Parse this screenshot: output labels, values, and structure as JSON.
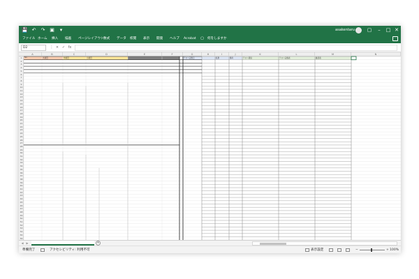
{
  "titlebar": {
    "user": "asakentaru",
    "quick_access": [
      "save-icon",
      "undo-icon",
      "redo-icon",
      "camera-icon",
      "dropdown-icon"
    ],
    "window_controls": [
      "ribbon-display-icon",
      "minimize-icon",
      "maximize-icon",
      "close-icon"
    ]
  },
  "ribbon": {
    "tabs": [
      "ファイル",
      "ホーム",
      "挿入",
      "描画",
      "ページレイアウト",
      "数式",
      "データ",
      "校閲",
      "表示",
      "開発",
      "ヘルプ",
      "Acrobat"
    ],
    "tell_me": "何をしますか"
  },
  "formula_bar": {
    "name_box": "D2",
    "cancel": "×",
    "enter": "✓",
    "function": "fx",
    "value": ""
  },
  "grid": {
    "col_headers": [
      "A",
      "B",
      "C",
      "D",
      "E",
      "F",
      "G",
      "H",
      "I",
      "J",
      "K",
      "L",
      "M",
      "N"
    ],
    "row_headers": [
      "1",
      "2",
      "3",
      "4",
      "5",
      "6",
      "7",
      "8",
      "9",
      "10",
      "11",
      "12",
      "13",
      "14",
      "15",
      "16",
      "17",
      "18",
      "19",
      "20",
      "21",
      "22",
      "23",
      "24",
      "25",
      "26",
      "27",
      "28",
      "29",
      "30",
      "31",
      "32",
      "33",
      "34",
      "35",
      "36",
      "37",
      "38",
      "39",
      "40",
      "41",
      "42",
      "43",
      "44",
      "45",
      "46",
      "47",
      "48",
      "49",
      "50",
      "51",
      "52",
      "53",
      "54",
      "55",
      "56"
    ],
    "left_headers": [
      "No.",
      "大項目",
      "中項目",
      "小項目"
    ],
    "right_headers": [
      "テスト実施日",
      "結果",
      "備考",
      "テスト環境",
      "テスト実施者",
      "確認者"
    ]
  },
  "sheet_bar": {
    "prev": "◀",
    "next": "▶",
    "add": "+"
  },
  "status": {
    "ready": "準備完了",
    "accessibility": "アクセシビリティ: 利用不可",
    "display_settings": "表示設定",
    "zoom_minus": "−",
    "zoom_plus": "+",
    "zoom": "100%"
  },
  "colors": {
    "excel_green": "#217346",
    "header_orange": "#f8cbad",
    "header_yellow": "#ffe699",
    "header_gray": "#808080",
    "header_blue": "#dbe4f3",
    "header_lightgreen": "#e2efda"
  }
}
